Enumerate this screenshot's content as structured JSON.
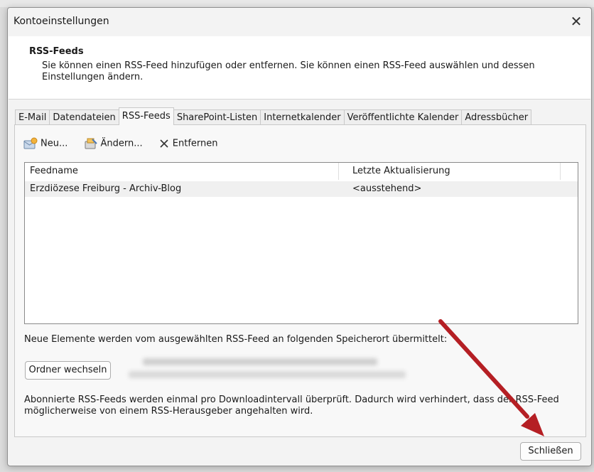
{
  "dialog": {
    "title": "Kontoeinstellungen",
    "close_glyph": "✕"
  },
  "header": {
    "title": "RSS-Feeds",
    "description": "Sie können einen RSS-Feed hinzufügen oder entfernen. Sie können einen RSS-Feed auswählen und dessen Einstellungen ändern."
  },
  "tabs": [
    {
      "label": "E-Mail",
      "active": false
    },
    {
      "label": "Datendateien",
      "active": false
    },
    {
      "label": "RSS-Feeds",
      "active": true
    },
    {
      "label": "SharePoint-Listen",
      "active": false
    },
    {
      "label": "Internetkalender",
      "active": false
    },
    {
      "label": "Veröffentlichte Kalender",
      "active": false
    },
    {
      "label": "Adressbücher",
      "active": false
    }
  ],
  "toolbar": {
    "new_label": "Neu...",
    "edit_label": "Ändern...",
    "remove_label": "Entfernen"
  },
  "table": {
    "columns": [
      "Feedname",
      "Letzte Aktualisierung"
    ],
    "rows": [
      {
        "feedname": "Erzdiözese Freiburg - Archiv-Blog",
        "last_update": "<ausstehend>"
      }
    ]
  },
  "deliver_text": "Neue Elemente werden vom ausgewählten RSS-Feed an folgenden Speicherort übermittelt:",
  "change_folder_label": "Ordner wechseln",
  "note_text": "Abonnierte RSS-Feeds werden einmal pro Downloadintervall überprüft. Dadurch wird verhindert, dass der RSS-Feed möglicherweise von einem RSS-Herausgeber angehalten wird.",
  "close_button_label": "Schließen",
  "colors": {
    "arrow": "#b51f24",
    "dialog_bg": "#f3f3f3",
    "panel_bg": "#ffffff"
  }
}
